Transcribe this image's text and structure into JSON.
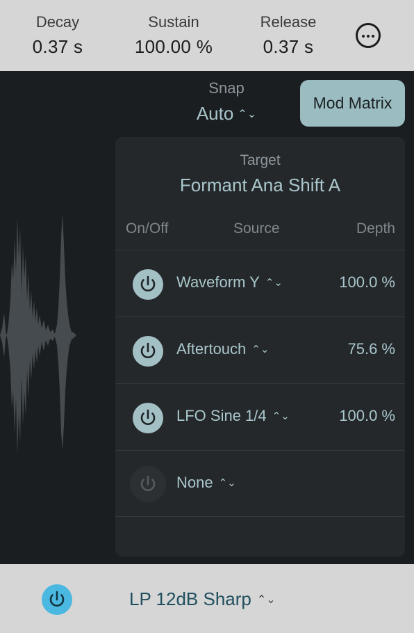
{
  "envelope": {
    "decay": {
      "label": "Decay",
      "value": "0.37 s"
    },
    "sustain": {
      "label": "Sustain",
      "value": "100.00 %"
    },
    "release": {
      "label": "Release",
      "value": "0.37 s"
    },
    "more_icon": "ellipsis-circle-icon"
  },
  "snap": {
    "label": "Snap",
    "value": "Auto",
    "chevron": "⌃⌄"
  },
  "mod_matrix_button": "Mod Matrix",
  "target": {
    "label": "Target",
    "value": "Formant Ana Shift A"
  },
  "columns": {
    "onoff": "On/Off",
    "source": "Source",
    "depth": "Depth"
  },
  "rows": [
    {
      "enabled": true,
      "source": "Waveform Y",
      "depth": "100.0 %"
    },
    {
      "enabled": true,
      "source": "Aftertouch",
      "depth": "75.6 %"
    },
    {
      "enabled": true,
      "source": "LFO Sine 1/4",
      "depth": "100.0 %"
    },
    {
      "enabled": false,
      "source": "None",
      "depth": ""
    }
  ],
  "filter": {
    "enabled": true,
    "type": "LP 12dB Sharp"
  },
  "colors": {
    "accent_teal": "#a9c7cc",
    "button_teal": "#9bbcc1",
    "filter_power_blue": "#4ab8e0",
    "panel_dark": "#1b1e21",
    "bar_gray": "#d6d6d6"
  }
}
